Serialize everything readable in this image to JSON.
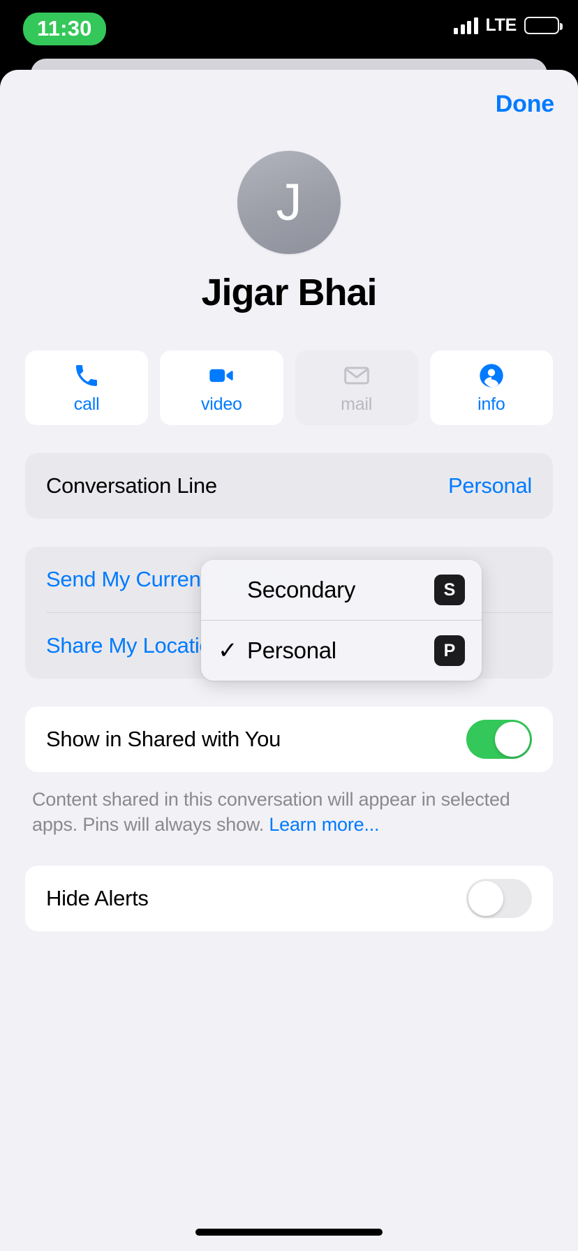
{
  "status_bar": {
    "time": "11:30",
    "carrier": "LTE",
    "signal_icon": "cellular-bars-icon",
    "battery_icon": "battery-icon",
    "time_pill_color": "#34C759"
  },
  "nav": {
    "done_label": "Done"
  },
  "contact": {
    "monogram": "J",
    "name": "Jigar Bhai"
  },
  "actions": [
    {
      "label": "call",
      "icon": "phone-icon",
      "enabled": true
    },
    {
      "label": "video",
      "icon": "video-camera-icon",
      "enabled": true
    },
    {
      "label": "mail",
      "icon": "envelope-icon",
      "enabled": false
    },
    {
      "label": "info",
      "icon": "person-circle-icon",
      "enabled": true
    }
  ],
  "conversation_line": {
    "title": "Conversation Line",
    "value": "Personal"
  },
  "location_rows": [
    {
      "label": "Send My Current Location"
    },
    {
      "label": "Share My Location"
    }
  ],
  "shared_with_you": {
    "title": "Show in Shared with You",
    "toggle_on": true,
    "note_text": "Content shared in this conversation will appear in selected apps. Pins will always show. ",
    "note_link": "Learn more..."
  },
  "hide_alerts": {
    "title": "Hide Alerts",
    "toggle_on": false
  },
  "popup_menu": {
    "items": [
      {
        "label": "Secondary",
        "badge": "S",
        "checked": false,
        "check_glyph": ""
      },
      {
        "label": "Personal",
        "badge": "P",
        "checked": true,
        "check_glyph": "✓"
      }
    ]
  },
  "colors": {
    "accent_blue": "#007AFF",
    "toggle_green": "#34C759",
    "background": "#F1F1F6",
    "badge_black": "#1C1C1E"
  }
}
